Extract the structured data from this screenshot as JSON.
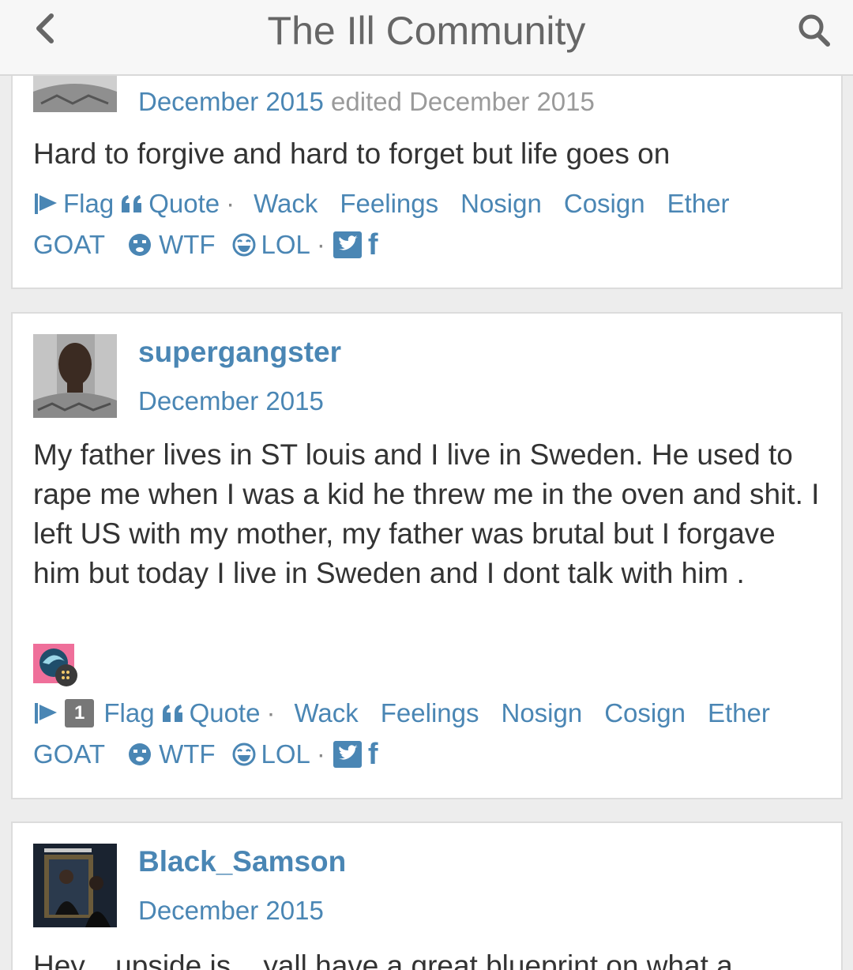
{
  "header": {
    "title": "The Ill Community",
    "back_icon": "chevron-left-icon",
    "search_icon": "search-icon"
  },
  "posts": [
    {
      "author": "",
      "date": "December 2015",
      "edited": "edited December 2015",
      "body": "Hard to forgive and hard to forget but life goes on",
      "flag_count": null
    },
    {
      "author": "supergangster",
      "date": "December 2015",
      "edited": "",
      "body": "My father lives in ST louis and I live in Sweden. He used to rape me when I was a kid he threw me in the oven and shit. I left US with my mother, my father was brutal but I forgave him but today I live in Sweden and I dont talk with him .",
      "flag_count": "1"
    },
    {
      "author": "Black_Samson",
      "date": "December 2015",
      "edited": "",
      "body": "Hey... upside is... yall have a great blueprint on what a",
      "flag_count": null
    }
  ],
  "actions": {
    "flag": "Flag",
    "quote": "Quote",
    "separator": "·",
    "wack": "Wack",
    "feelings": "Feelings",
    "nosign": "Nosign",
    "cosign": "Cosign",
    "ether": "Ether",
    "goat": "GOAT",
    "wtf": "WTF",
    "lol": "LOL",
    "facebook_glyph": "f"
  },
  "colors": {
    "link": "#4a86b4",
    "text": "#333333",
    "muted": "#9a9a9a",
    "header_bg": "#f7f7f7",
    "page_bg": "#ededed"
  }
}
